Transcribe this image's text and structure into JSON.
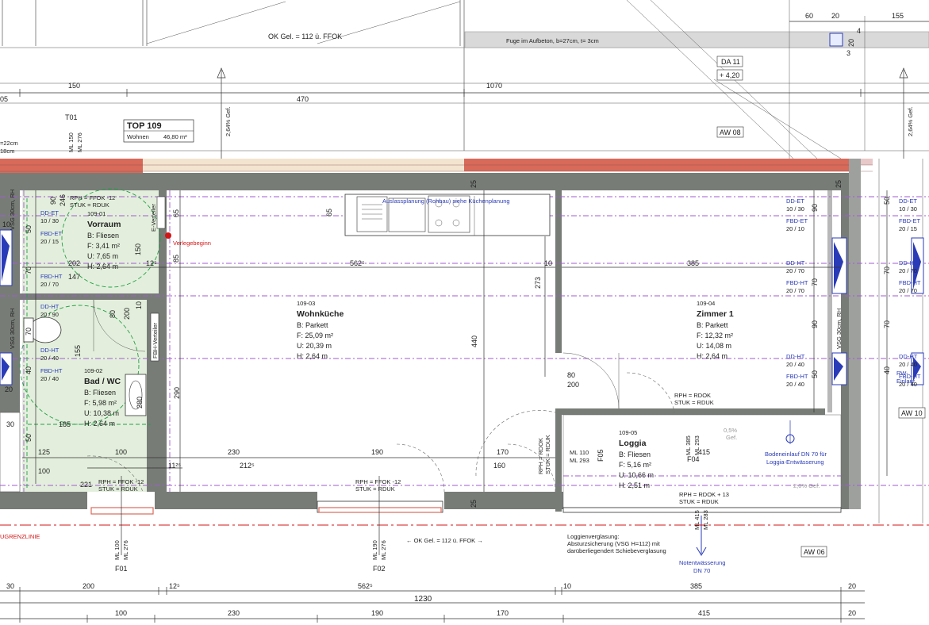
{
  "colors": {
    "wall": "#777c77",
    "insulation": "#e8c8c8",
    "brick": "#d86a5a",
    "tile_floor": "#e3efdc",
    "annotation_blue": "#2a3bb8",
    "boundary_red": "#d01616",
    "purple_line": "#a15bd0",
    "green_line": "#23a046"
  },
  "top": {
    "ok_gel_top": "OK Gel. = 112 ü. FFOK",
    "fuge": "Fuge im Aufbeton, b=27cm, t= 3cm",
    "da_tag": "DA 11",
    "da_height": "+ 4,20",
    "aw08": "AW 08",
    "slope_left": "2,64% Gef.",
    "slope_right": "2,64% Gef.",
    "dim_60": "60",
    "dim_20a": "20",
    "dim_155": "155",
    "dim_20b": "20",
    "dim_4": "4",
    "dim_3": "3",
    "dim_05": "05",
    "dim_150": "150",
    "dim_470": "470",
    "dim_1070": "1070",
    "frag_22": "=22cm",
    "frag_18": "18cm"
  },
  "unit": {
    "name": "TOP 109",
    "type": "Wohnen",
    "area": "46,80 m²"
  },
  "window_t01": {
    "label": "T01",
    "ml150": "ML 150",
    "ml276": "ML 276"
  },
  "rooms": {
    "vorraum": {
      "id": "109-01",
      "name": "Vorraum",
      "b": "B: Fliesen",
      "f": "F: 3,41 m²",
      "u": "U: 7,65 m",
      "h": "H: 2,64 m"
    },
    "bad": {
      "id": "109-02",
      "name": "Bad / WC",
      "b": "B: Fliesen",
      "f": "F: 5,98 m²",
      "u": "U: 10,38 m",
      "h": "H: 2,64 m"
    },
    "wohnkueche": {
      "id": "109-03",
      "name": "Wohnküche",
      "b": "B: Parkett",
      "f": "F: 25,09 m²",
      "u": "U: 20,39 m",
      "h": "H: 2,64 m"
    },
    "zimmer1": {
      "id": "109-04",
      "name": "Zimmer 1",
      "b": "B: Parkett",
      "f": "F: 12,32 m²",
      "u": "U: 14,08 m",
      "h": "H: 2,64 m"
    },
    "loggia": {
      "id": "109-05",
      "name": "Loggia",
      "b": "B: Fliesen",
      "f": "F: 5,16 m²",
      "u": "U: 10,66 m",
      "h": "H: 2,51 m"
    }
  },
  "annotations": {
    "kitchen": "Auslassplanung (Rohbau) siehe Küchenplanung",
    "verlege": "Verlegebeginn",
    "e_verteiler": "E-Verteiler",
    "fbh_verteiler": "FBH-Verteiler",
    "rph_top_l1": "RPH = FFOK -12",
    "rph_top_l2": "STUK = RDUK",
    "rph_bl1": "RPH = FFOK -12",
    "rph_bl2": "STUK = RDUK",
    "rph_bm1": "RPH = FFOK -12",
    "rph_bm2": "STUK = RDUK",
    "rph_z1": "RPH = RDOK",
    "rph_z2": "STUK = RDUK",
    "rph_loggia1": "RPH = RDOK + 13",
    "rph_loggia2": "STUK = RDUK",
    "rph_vert1": "RPH = RDOK",
    "rph_vert2": "STUK = RDUK",
    "bodeneinlauf1": "Bodeneinlauf DN 70 für",
    "bodeneinlauf2": "Loggia-Entwässerung",
    "slope_05": "0,5%",
    "slope_05b": "Gef.",
    "slope_20": "2,0% Gef.",
    "notent1": "Notentwässerung",
    "notent2": "DN 70",
    "loggia_glas1": "Loggienverglasung:",
    "loggia_glas2": "Absturzsicherung (VSG H=112) mit",
    "loggia_glas3": "darüberliegendert Schiebeverglasung",
    "ok_gel_bottom": "← OK Gel. = 112 ü. FFOK →",
    "grenzlinie": "UGRENZLINIE",
    "aw06": "AW 06",
    "aw10": "AW 10",
    "rw_einlauf1": "RW-",
    "rw_einlauf2": "Einlauf",
    "vsg_left": "VSG 30cm, RH",
    "vsg_right": "VSG 30cm, RH",
    "vsg_left2": "VSG 30cm, RH"
  },
  "openings": [
    {
      "key": "dd_et_a",
      "l1": "DD-ET",
      "l2": "10 / 30"
    },
    {
      "key": "fbd_et_a",
      "l1": "FBD-ET",
      "l2": "20 / 15"
    },
    {
      "key": "fbd_ht_a",
      "l1": "FBD-HT",
      "l2": "20 / 70"
    },
    {
      "key": "dd_ht_a",
      "l1": "DD-HT",
      "l2": "20 / 90"
    },
    {
      "key": "dd_ht_b",
      "l1": "DD-HT",
      "l2": "20 / 40"
    },
    {
      "key": "fbd_ht_b",
      "l1": "FBD-HT",
      "l2": "20 / 40"
    },
    {
      "key": "dd_et_z",
      "l1": "DD-ET",
      "l2": "10 / 30"
    },
    {
      "key": "fbd_et_z",
      "l1": "FBD-ET",
      "l2": "20 / 10"
    },
    {
      "key": "dd_ht_z",
      "l1": "DD-HT",
      "l2": "20 / 70"
    },
    {
      "key": "fbd_ht_z",
      "l1": "FBD-HT",
      "l2": "20 / 70"
    },
    {
      "key": "dd_ht_z2",
      "l1": "DD-HT",
      "l2": "20 / 40"
    },
    {
      "key": "fbd_ht_z2",
      "l1": "FBD-HT",
      "l2": "20 / 40"
    },
    {
      "key": "dd_et_r",
      "l1": "DD-ET",
      "l2": "10 / 30"
    },
    {
      "key": "fbd_et_r",
      "l1": "FBD-ET",
      "l2": "20 / 15"
    },
    {
      "key": "dd_ht_r",
      "l1": "DD-HT",
      "l2": "20 / 70"
    },
    {
      "key": "fbd_ht_r",
      "l1": "FBD-HT",
      "l2": "20 / 70"
    },
    {
      "key": "dd_ht_r2",
      "l1": "DD-HT",
      "l2": "20 / 40"
    },
    {
      "key": "fbd_ht_r2",
      "l1": "FBD-HT",
      "l2": "20 / 40"
    }
  ],
  "windows": {
    "f01": {
      "label": "F01",
      "ml_w": "ML 100",
      "ml_h": "ML 276"
    },
    "f02": {
      "label": "F02",
      "ml_w": "ML 190",
      "ml_h": "ML 276"
    },
    "f04": {
      "label": "F04",
      "ml_w": "ML 385",
      "ml_h": "ML 293"
    },
    "f05": {
      "label": "F05",
      "ml_w": "ML 110",
      "ml_h": "ML 293"
    },
    "bottom": {
      "ml_w": "ML 415",
      "ml_h": "ML 283"
    }
  },
  "dims": {
    "d90": "90",
    "d246": "246",
    "d50": "50",
    "d70a": "70",
    "d150": "150",
    "d65a": "65",
    "d85": "85",
    "d202": "202",
    "d12": "12⁵",
    "d147": "147",
    "d562": "562⁵",
    "d10a": "10",
    "d385a": "385",
    "d65b": "65",
    "d273": "273",
    "d440": "440",
    "d80": "80",
    "d200a": "200",
    "d10b": "10",
    "d80b": "80",
    "d200b": "200",
    "d10c": "10",
    "d290": "290",
    "d280": "280",
    "d155": "155",
    "d185": "185",
    "d40": "40",
    "d70b": "70",
    "d50b": "50",
    "d20": "20",
    "d30": "30",
    "d125": "125",
    "d100a": "100",
    "d230a": "230",
    "d2125": "212⁵",
    "d190a": "190",
    "d170a": "170",
    "d160": "160",
    "d415a": "415",
    "d1125": "11²⁵",
    "d100b": "100",
    "d221": "221",
    "d25a": "25",
    "d25b": "25",
    "d25c": "25",
    "d90z": "90",
    "d70z": "70",
    "d90z2": "90",
    "d50z": "50",
    "d10z": "10",
    "b30": "30",
    "b200": "200",
    "b125": "12⁵",
    "b5625": "562⁵",
    "b10": "10",
    "b385": "385",
    "b20": "20",
    "b1230": "1230",
    "b100": "100",
    "b230": "230",
    "b190": "190",
    "b170": "170",
    "b415": "415",
    "b20b": "20",
    "l10": "10",
    "l70": "70",
    "l50": "50",
    "l70b": "70",
    "l40": "40"
  }
}
